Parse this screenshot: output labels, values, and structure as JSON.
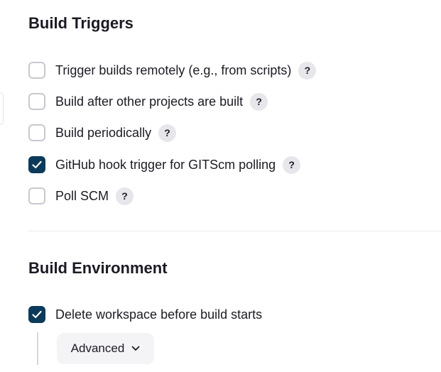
{
  "build_triggers": {
    "title": "Build Triggers",
    "items": [
      {
        "label": "Trigger builds remotely (e.g., from scripts)",
        "checked": false,
        "help": "?"
      },
      {
        "label": "Build after other projects are built",
        "checked": false,
        "help": "?"
      },
      {
        "label": "Build periodically",
        "checked": false,
        "help": "?"
      },
      {
        "label": "GitHub hook trigger for GITScm polling",
        "checked": true,
        "help": "?"
      },
      {
        "label": "Poll SCM",
        "checked": false,
        "help": "?"
      }
    ]
  },
  "build_environment": {
    "title": "Build Environment",
    "items": [
      {
        "label": "Delete workspace before build starts",
        "checked": true
      }
    ],
    "advanced_button": {
      "label": "Advanced",
      "icon": "chevron-down-icon"
    }
  },
  "colors": {
    "checkbox_checked": "#0b3a5a",
    "checkbox_border": "#c8c8d0",
    "help_bg": "#e6e6eb",
    "button_bg": "#f4f4f6"
  }
}
